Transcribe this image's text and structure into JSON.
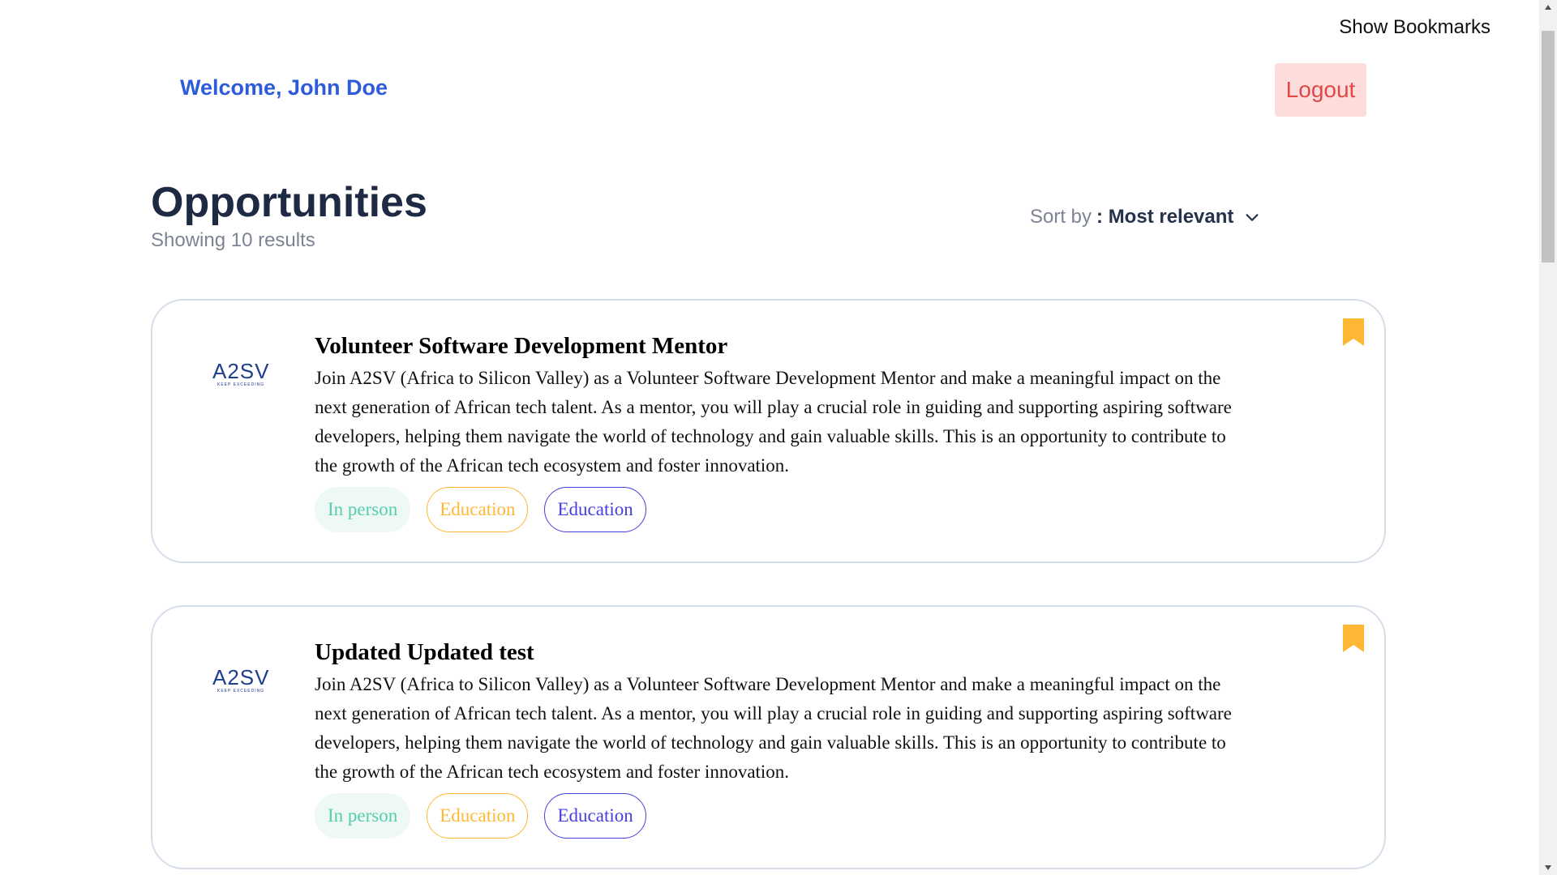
{
  "header": {
    "show_bookmarks": "Show Bookmarks",
    "welcome": "Welcome, John Doe",
    "logout": "Logout"
  },
  "page": {
    "title": "Opportunities",
    "subtitle": "Showing 10 results"
  },
  "sort": {
    "label": "Sort by",
    "value": ": Most relevant",
    "icon": "chevron-down-icon"
  },
  "opportunities": [
    {
      "title": "Volunteer Software Development Mentor",
      "description": "Join A2SV (Africa to Silicon Valley) as a Volunteer Software Development Mentor and make a meaningful impact on the next generation of African tech talent. As a mentor, you will play a crucial role in guiding and supporting aspiring software developers, helping them navigate the world of technology and gain valuable skills. This is an opportunity to contribute to the growth of the African tech ecosystem and foster innovation.",
      "tags": [
        "In person",
        "Education",
        "Education"
      ],
      "logo": "A2SV",
      "logo_tagline": "KEEP EXCEEDING",
      "bookmarked": true
    },
    {
      "title": "Updated Updated test",
      "description": "Join A2SV (Africa to Silicon Valley) as a Volunteer Software Development Mentor and make a meaningful impact on the next generation of African tech talent. As a mentor, you will play a crucial role in guiding and supporting aspiring software developers, helping them navigate the world of technology and gain valuable skills. This is an opportunity to contribute to the growth of the African tech ecosystem and foster innovation.",
      "tags": [
        "In person",
        "Education",
        "Education"
      ],
      "logo": "A2SV",
      "logo_tagline": "KEEP EXCEEDING",
      "bookmarked": true
    }
  ],
  "colors": {
    "welcome": "#2D5BDB",
    "logout_bg": "#FDDCDC",
    "logout_text": "#E04848",
    "bookmark": "#FFB836",
    "tag_inperson": "#56CDAD",
    "tag_orange": "#FFB836",
    "tag_purple": "#4640DE",
    "card_border": "#D6DDEB"
  },
  "scroll": {
    "position_fraction": 0
  }
}
